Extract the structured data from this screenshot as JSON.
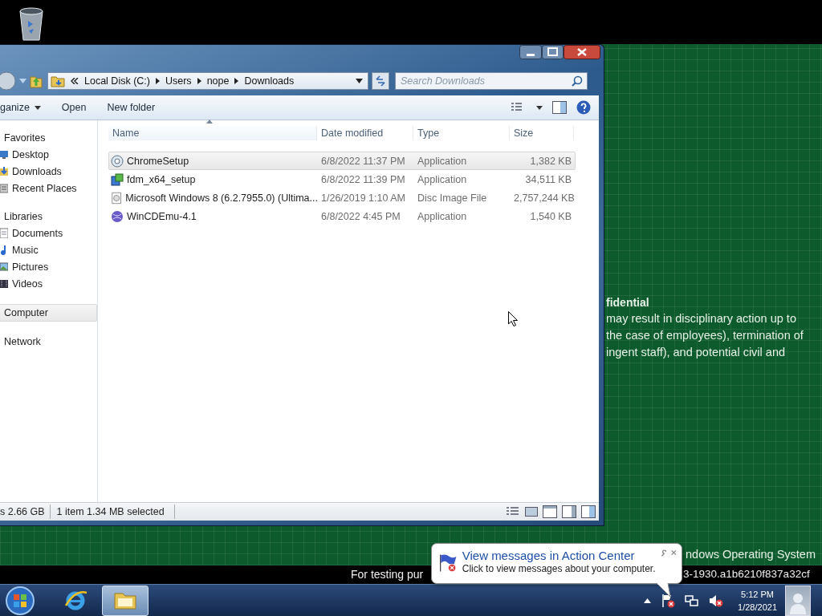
{
  "wallpaper": {
    "heading": "fidential",
    "lines": [
      "may result in disciplinary action up to",
      "the case of employees), termination of",
      "ingent staff), and potential civil and"
    ],
    "caption": "ndows Operating System",
    "strip_left": "For testing pur",
    "strip_right": "3-1930.a1b6210f837a32cf"
  },
  "explorer": {
    "address": {
      "crumbs": [
        "Local Disk (C:)",
        "Users",
        "nope",
        "Downloads"
      ]
    },
    "search": {
      "placeholder": "Search Downloads"
    },
    "toolbar": [
      {
        "label": "ganize",
        "kind": "menu"
      },
      {
        "label": "Open",
        "kind": "plain"
      },
      {
        "label": "New folder",
        "kind": "plain"
      }
    ],
    "sidebar": [
      {
        "label": "Favorites",
        "selected": false,
        "children": [
          {
            "label": "Desktop",
            "kind": "desktop",
            "selected": false
          },
          {
            "label": "Downloads",
            "kind": "downloads",
            "selected": false
          },
          {
            "label": "Recent Places",
            "kind": "recent",
            "selected": false
          }
        ]
      },
      {
        "label": "Libraries",
        "selected": false,
        "children": [
          {
            "label": "Documents",
            "kind": "documents",
            "selected": false
          },
          {
            "label": "Music",
            "kind": "music",
            "selected": false
          },
          {
            "label": "Pictures",
            "kind": "pictures",
            "selected": false
          },
          {
            "label": "Videos",
            "kind": "videos",
            "selected": false
          }
        ]
      },
      {
        "label": "Computer",
        "selected": true
      },
      {
        "label": "Network",
        "selected": false
      }
    ],
    "columns": [
      {
        "label": "Name",
        "sorted": true
      },
      {
        "label": "Date modified",
        "sorted": false
      },
      {
        "label": "Type",
        "sorted": false
      },
      {
        "label": "Size",
        "sorted": false
      }
    ],
    "rows": [
      {
        "name": "ChromeSetup",
        "date": "6/8/2022 11:37 PM",
        "type": "Application",
        "size": "1,382 KB",
        "kind": "setup",
        "selected": true
      },
      {
        "name": "fdm_x64_setup",
        "date": "6/8/2022 11:39 PM",
        "type": "Application",
        "size": "34,511 KB",
        "kind": "installer",
        "selected": false
      },
      {
        "name": "Microsoft Windows 8 (6.2.7955.0) (Ultima...",
        "date": "1/26/2019 1:10 AM",
        "type": "Disc Image File",
        "size": "2,757,244 KB",
        "kind": "disc",
        "selected": false
      },
      {
        "name": "WinCDEmu-4.1",
        "date": "6/8/2022 4:45 PM",
        "type": "Application",
        "size": "1,540 KB",
        "kind": "globe",
        "selected": false
      }
    ],
    "status": [
      "s 2.66 GB",
      "1 item 1.34 MB selected"
    ]
  },
  "notification": {
    "title": "View messages in Action Center",
    "body": "Click to view messages about your computer."
  },
  "taskbar": {
    "buttons": [
      {
        "kind": "browser",
        "selected": false
      },
      {
        "kind": "folder",
        "selected": true
      }
    ],
    "clock": {
      "time": "5:12 PM",
      "date": "1/28/2021"
    }
  }
}
